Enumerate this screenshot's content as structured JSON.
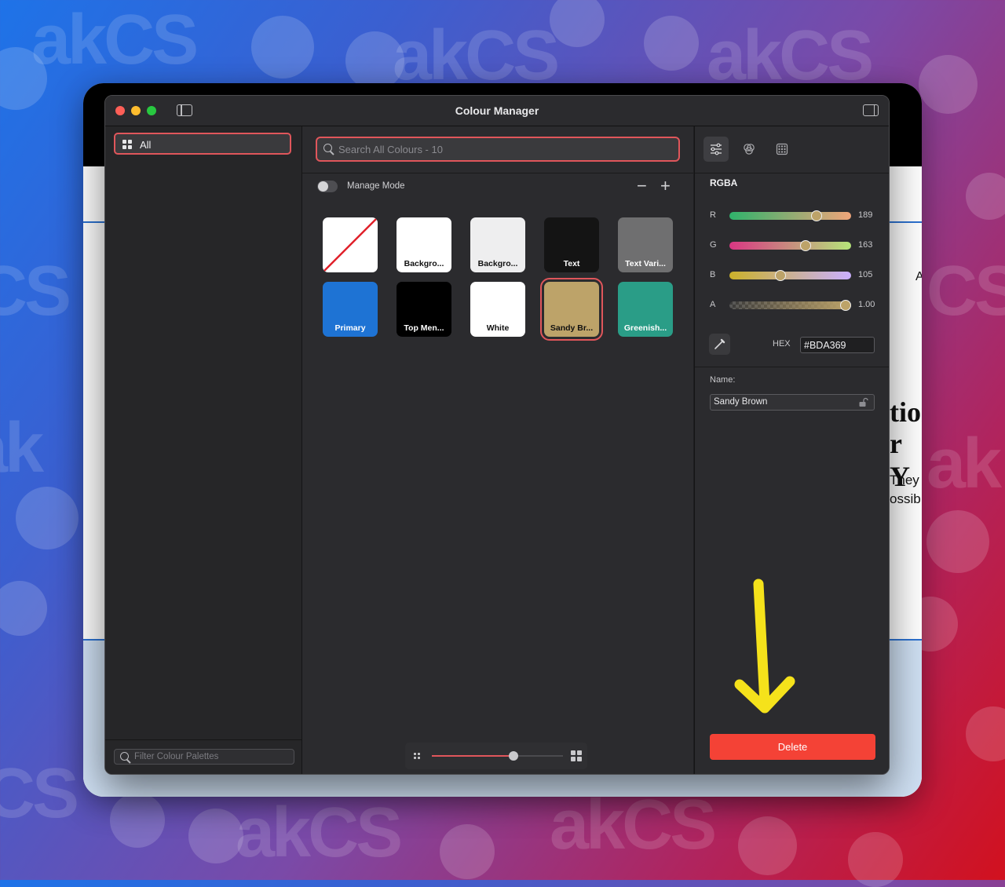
{
  "window": {
    "title": "Colour Manager"
  },
  "background_page": {
    "peek_lines": [
      "tior",
      "r Y",
      "They",
      "ossib",
      "A"
    ]
  },
  "sidebar": {
    "items": [
      {
        "label": "All",
        "selected": true
      }
    ],
    "filter_placeholder": "Filter Colour Palettes"
  },
  "search": {
    "placeholder": "Search All Colours - 10"
  },
  "manage_mode": {
    "label": "Manage Mode",
    "enabled": false,
    "remove_symbol": "−",
    "add_symbol": "+"
  },
  "swatches": [
    {
      "name": "",
      "color": "#ffffff",
      "kind": "none"
    },
    {
      "name": "Backgro...",
      "color": "#ffffff",
      "text_color": "#111111"
    },
    {
      "name": "Backgro...",
      "color": "#eeeeef",
      "text_color": "#111111"
    },
    {
      "name": "Text",
      "color": "#141414",
      "text_color": "#ffffff"
    },
    {
      "name": "Text Vari...",
      "color": "#6f6f70",
      "text_color": "#ffffff"
    },
    {
      "name": "Primary",
      "color": "#1e73d4",
      "text_color": "#ffffff"
    },
    {
      "name": "Top Men...",
      "color": "#000000",
      "text_color": "#ffffff"
    },
    {
      "name": "White",
      "color": "#ffffff",
      "text_color": "#111111"
    },
    {
      "name": "Sandy Br...",
      "color": "#bda369",
      "text_color": "#111111",
      "selected": true
    },
    {
      "name": "Greenish...",
      "color": "#2a9d87",
      "text_color": "#ffffff"
    }
  ],
  "zoom": {
    "level": 0.62
  },
  "inspector": {
    "mode_title": "RGBA",
    "channels": [
      {
        "label": "R",
        "value": "189",
        "fraction": 0.741
      },
      {
        "label": "G",
        "value": "163",
        "fraction": 0.639
      },
      {
        "label": "B",
        "value": "105",
        "fraction": 0.412
      },
      {
        "label": "A",
        "value": "1.00",
        "fraction": 1.0
      }
    ],
    "hex_label": "HEX",
    "hex_value": "#BDA369",
    "name_label": "Name:",
    "name_value": "Sandy Brown",
    "delete_label": "Delete"
  },
  "colors": {
    "accent": "#e0565b",
    "delete": "#f44236",
    "annotation_arrow": "#f5e21b"
  }
}
